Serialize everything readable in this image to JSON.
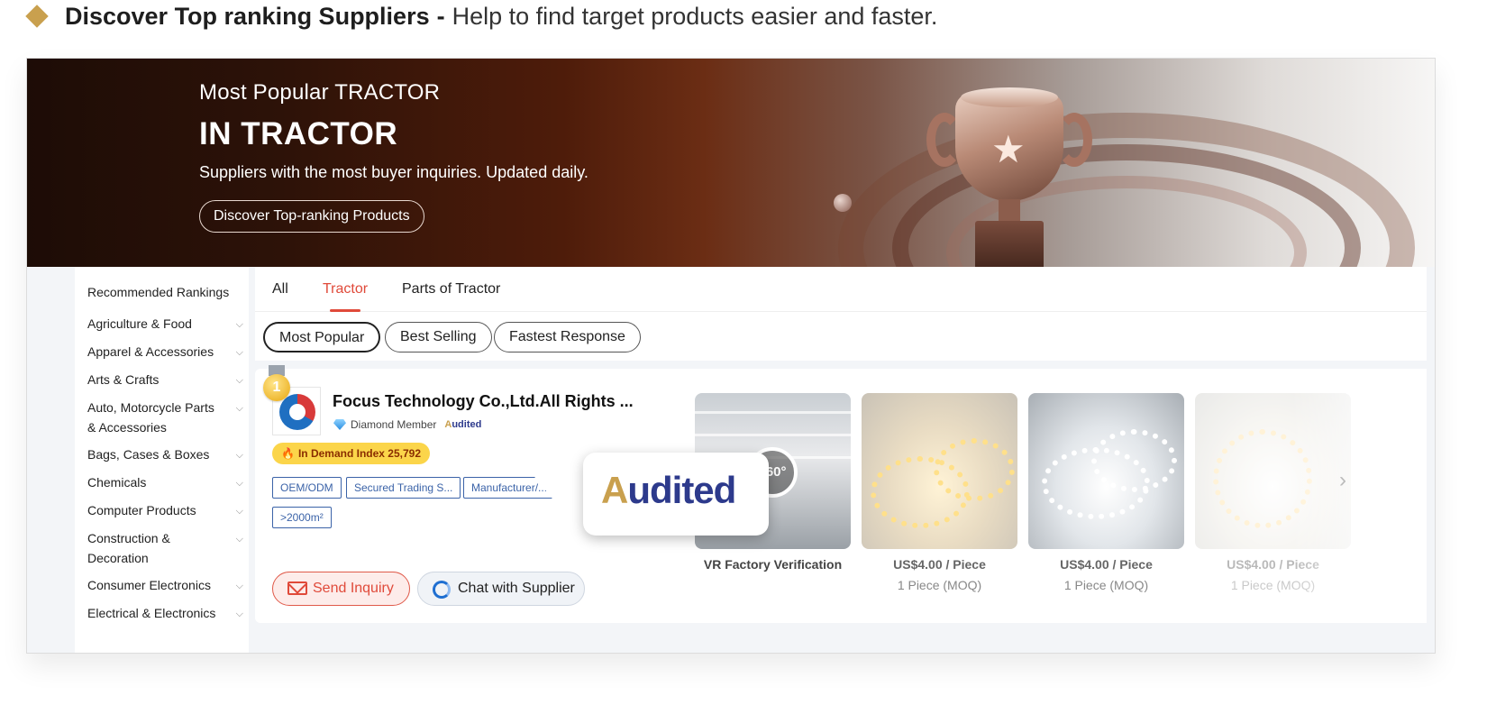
{
  "headline": {
    "bold": "Discover Top ranking Suppliers",
    "separator": "-",
    "rest": "Help to find target products easier and faster."
  },
  "banner": {
    "small_title": "Most Popular TRACTOR",
    "big_title": "IN TRACTOR",
    "subtitle": "Suppliers with the most buyer inquiries. Updated daily.",
    "button": "Discover Top-ranking Products"
  },
  "sidebar": {
    "heading": "Recommended Rankings",
    "items": [
      {
        "label": "Agriculture & Food"
      },
      {
        "label": "Apparel & Accessories"
      },
      {
        "label": "Arts & Crafts"
      },
      {
        "label": "Auto, Motorcycle Parts & Accessories"
      },
      {
        "label": "Bags, Cases & Boxes"
      },
      {
        "label": "Chemicals"
      },
      {
        "label": "Computer Products"
      },
      {
        "label": "Construction & Decoration"
      },
      {
        "label": "Consumer Electronics"
      },
      {
        "label": "Electrical & Electronics"
      }
    ],
    "chevron": "⌵"
  },
  "tabs": [
    {
      "label": "All",
      "active": false
    },
    {
      "label": "Tractor",
      "active": true
    },
    {
      "label": "Parts of Tractor",
      "active": false
    }
  ],
  "filters": [
    {
      "label": "Most Popular",
      "active": true
    },
    {
      "label": "Best Selling",
      "active": false
    },
    {
      "label": "Fastest Response",
      "active": false
    }
  ],
  "supplier": {
    "rank": "1",
    "name": "Focus Technology Co.,Ltd.All Rights ...",
    "member": "Diamond Member",
    "audited_mini_a": "A",
    "audited_mini_rest": "udited",
    "demand": "In Demand Index 25,792",
    "tags": [
      "OEM/ODM",
      "Secured Trading S...",
      "Manufacturer/...",
      ">2000m²"
    ],
    "send_inquiry": "Send Inquiry",
    "chat": "Chat with Supplier"
  },
  "products": [
    {
      "caption": "VR Factory Verification",
      "badge": "360°"
    },
    {
      "price": "US$4.00 / Piece",
      "moq": "1 Piece (MOQ)"
    },
    {
      "price": "US$4.00 / Piece",
      "moq": "1 Piece (MOQ)"
    },
    {
      "price": "US$4.00 / Piece",
      "moq": "1 Piece (MOQ)"
    }
  ],
  "callout": {
    "a": "A",
    "rest": "udited"
  },
  "icons": {
    "next": "›",
    "flame": "🔥",
    "star": "★"
  },
  "colors": {
    "accent_red": "#e04a3a",
    "tag_blue": "#3b63a8",
    "gold": "#c9a04e",
    "demand_yellow": "#fbd54a"
  }
}
